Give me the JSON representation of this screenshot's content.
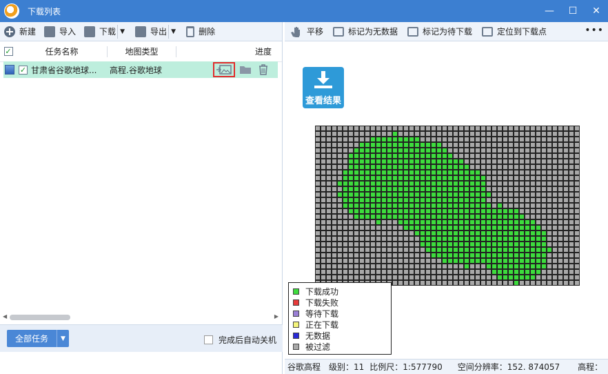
{
  "window": {
    "title": "下载列表",
    "controls": {
      "minimize": "—",
      "maximize": "☐",
      "close": "✕"
    }
  },
  "left_toolbar": {
    "new": "新建",
    "import": "导入",
    "download": "下载",
    "export": "导出",
    "delete": "删除"
  },
  "task_table": {
    "columns": [
      "任务名称",
      "地图类型",
      "进度"
    ],
    "rows": [
      {
        "checked": true,
        "name": "甘肃省谷歌地球...",
        "map_type": "高程.谷歌地球"
      }
    ]
  },
  "left_footer": {
    "all_tasks": "全部任务",
    "auto_shutdown": "完成后自动关机"
  },
  "right_toolbar": {
    "pan": "平移",
    "mark_no_data": "标记为无数据",
    "mark_pending": "标记为待下载",
    "locate": "定位到下载点",
    "more": "•••"
  },
  "view_result": "查看结果",
  "legend": [
    {
      "label": "下载成功",
      "color": "#3ddc3d"
    },
    {
      "label": "下载失败",
      "color": "#e83a3a"
    },
    {
      "label": "等待下载",
      "color": "#9a7fd6"
    },
    {
      "label": "正在下载",
      "color": "#f4f47a"
    },
    {
      "label": "无数据",
      "color": "#2a2ad8"
    },
    {
      "label": "被过滤",
      "color": "#a8a8a8"
    }
  ],
  "status_bar": {
    "source": "谷歌高程",
    "level": "级别：11",
    "scale": "比例尺：1:577790",
    "resolution": "空间分辨率：152. 874057",
    "elevation": "高程："
  },
  "tile_grid": {
    "cols": 48,
    "rows": 29,
    "colors": {
      "success": "#3ddc3d",
      "filtered": "#a8a8a8",
      "border": "#222222"
    }
  }
}
